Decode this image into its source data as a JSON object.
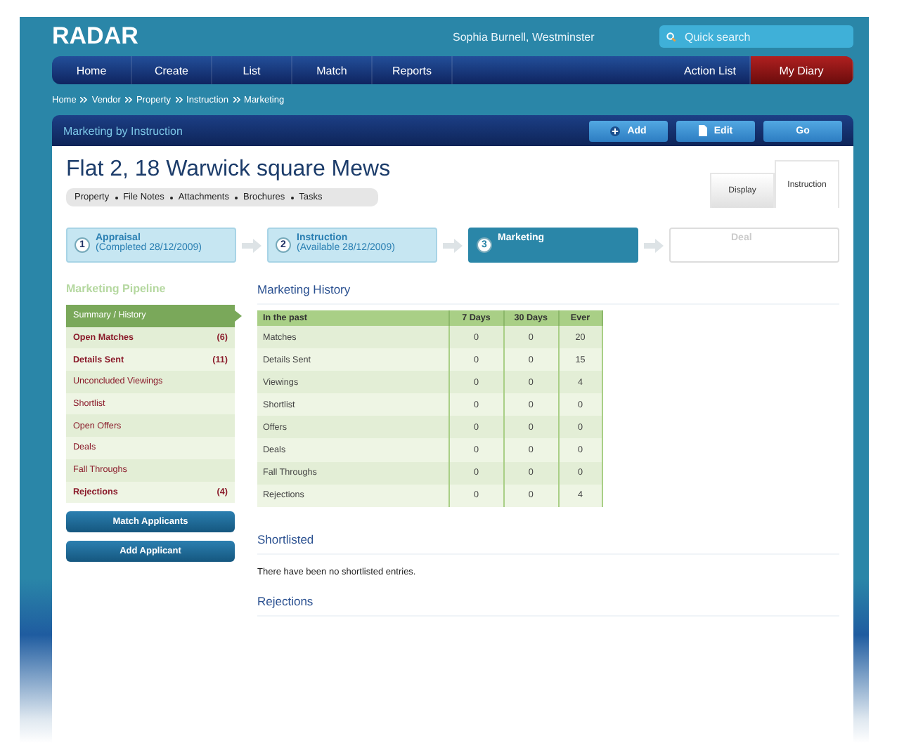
{
  "header": {
    "logo": "RADAR",
    "user": "Sophia Burnell, Westminster",
    "search": {
      "placeholder": "Quick search"
    }
  },
  "nav": {
    "left": [
      {
        "label": "Home",
        "selected": false
      },
      {
        "label": "Create",
        "selected": false
      },
      {
        "label": "List",
        "selected": false
      },
      {
        "label": "Match",
        "selected": false
      },
      {
        "label": "Reports",
        "selected": false
      }
    ],
    "right": [
      {
        "label": "Action List",
        "selected": false
      },
      {
        "label": "My Diary",
        "selected": true
      }
    ]
  },
  "breadcrumb": [
    "Home",
    "Vendor",
    "Property",
    "Instruction",
    "Marketing"
  ],
  "panel": {
    "title": "Marketing by Instruction",
    "buttons": [
      {
        "label": "Add",
        "kind": "add"
      },
      {
        "label": "Edit",
        "kind": "edit"
      },
      {
        "label": "Go",
        "kind": "plain"
      }
    ]
  },
  "property": {
    "title": "Flat 2, 18 Warwick square Mews",
    "subtabs": [
      "Property",
      "File Notes",
      "Attachments",
      "Brochures",
      "Tasks"
    ],
    "view_tabs": [
      {
        "label": "Display",
        "selected": false
      },
      {
        "label": "Instruction",
        "selected": true
      }
    ]
  },
  "steps": [
    {
      "number": "1",
      "title": "Appraisal",
      "detail": "(Completed 28/12/2009)",
      "kind": "done"
    },
    {
      "number": "2",
      "title": "Instruction",
      "detail": "(Available 28/12/2009)",
      "kind": "done"
    },
    {
      "number": "3",
      "title": "Marketing",
      "kind": "current"
    },
    {
      "title": "Deal",
      "kind": "upcoming"
    }
  ],
  "pipeline": {
    "title": "Marketing Pipeline",
    "items": [
      {
        "label": "Summary / History",
        "selected": true,
        "bold": false
      },
      {
        "label": "Open Matches",
        "count": "(6)",
        "selected": false,
        "bold": true
      },
      {
        "label": "Details Sent",
        "count": "(11)",
        "selected": false,
        "bold": true
      },
      {
        "label": "Unconcluded Viewings",
        "selected": false,
        "bold": false
      },
      {
        "label": "Shortlist",
        "selected": false,
        "bold": false
      },
      {
        "label": "Open Offers",
        "selected": false,
        "bold": false
      },
      {
        "label": "Deals",
        "selected": false,
        "bold": false
      },
      {
        "label": "Fall Throughs",
        "selected": false,
        "bold": false
      },
      {
        "label": "Rejections",
        "count": "(4)",
        "selected": false,
        "bold": true
      }
    ],
    "buttons": [
      "Match Applicants",
      "Add Applicant"
    ]
  },
  "history": {
    "title": "Marketing History",
    "columns": [
      "In the past",
      "7 Days",
      "30 Days",
      "Ever"
    ],
    "rows": [
      [
        "Matches",
        "0",
        "0",
        "20"
      ],
      [
        "Details Sent",
        "0",
        "0",
        "15"
      ],
      [
        "Viewings",
        "0",
        "0",
        "4"
      ],
      [
        "Shortlist",
        "0",
        "0",
        "0"
      ],
      [
        "Offers",
        "0",
        "0",
        "0"
      ],
      [
        "Deals",
        "0",
        "0",
        "0"
      ],
      [
        "Fall Throughs",
        "0",
        "0",
        "0"
      ],
      [
        "Rejections",
        "0",
        "0",
        "4"
      ]
    ]
  },
  "shortlisted": {
    "title": "Shortlisted",
    "text": "There have been no shortlisted entries."
  },
  "rejections": {
    "title": "Rejections"
  }
}
